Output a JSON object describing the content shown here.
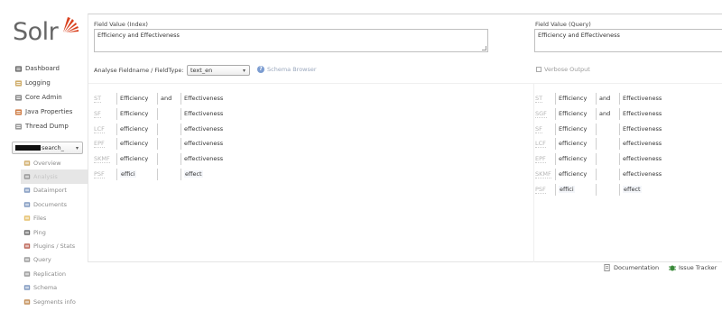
{
  "logo": {
    "text": "Solr",
    "accent_color": "#d9411e"
  },
  "nav": [
    {
      "label": "Dashboard",
      "icon": "dashboard-icon"
    },
    {
      "label": "Logging",
      "icon": "logging-icon"
    },
    {
      "label": "Core Admin",
      "icon": "core-admin-icon"
    },
    {
      "label": "Java Properties",
      "icon": "java-icon"
    },
    {
      "label": "Thread Dump",
      "icon": "thread-dump-icon"
    }
  ],
  "core_selector": {
    "value": "search_"
  },
  "core_menu": [
    {
      "label": "Overview",
      "icon": "overview-icon"
    },
    {
      "label": "Analysis",
      "icon": "analysis-icon",
      "active": true
    },
    {
      "label": "Dataimport",
      "icon": "dataimport-icon"
    },
    {
      "label": "Documents",
      "icon": "documents-icon"
    },
    {
      "label": "Files",
      "icon": "files-icon"
    },
    {
      "label": "Ping",
      "icon": "ping-icon"
    },
    {
      "label": "Plugins / Stats",
      "icon": "plugins-icon"
    },
    {
      "label": "Query",
      "icon": "query-icon"
    },
    {
      "label": "Replication",
      "icon": "replication-icon"
    },
    {
      "label": "Schema",
      "icon": "schema-icon"
    },
    {
      "label": "Segments info",
      "icon": "segments-icon"
    }
  ],
  "analysis": {
    "index_label": "Field Value (Index)",
    "index_value": "Efficiency and Effectiveness",
    "query_label": "Field Value (Query)",
    "query_value": "Efficiency and Effectiveness",
    "fieldtype_label": "Analyse Fieldname / FieldType:",
    "fieldtype_value": "text_en",
    "schema_browser": "Schema Browser",
    "verbose_label": "Verbose Output"
  },
  "index_rows": [
    {
      "stage": "ST",
      "t1": "Efficiency",
      "t2": "and",
      "t3": "Effectiveness"
    },
    {
      "stage": "SF",
      "t1": "Efficiency",
      "t2": "",
      "t3": "Effectiveness"
    },
    {
      "stage": "LCF",
      "t1": "efficiency",
      "t2": "",
      "t3": "effectiveness"
    },
    {
      "stage": "EPF",
      "t1": "efficiency",
      "t2": "",
      "t3": "effectiveness"
    },
    {
      "stage": "SKMF",
      "t1": "efficiency",
      "t2": "",
      "t3": "effectiveness"
    },
    {
      "stage": "PSF",
      "t1": "effici",
      "t2": "",
      "t3": "effect"
    }
  ],
  "query_rows": [
    {
      "stage": "ST",
      "t1": "Efficiency",
      "t2": "and",
      "t3": "Effectiveness"
    },
    {
      "stage": "SGF",
      "t1": "Efficiency",
      "t2": "and",
      "t3": "Effectiveness"
    },
    {
      "stage": "SF",
      "t1": "Efficiency",
      "t2": "",
      "t3": "Effectiveness"
    },
    {
      "stage": "LCF",
      "t1": "efficiency",
      "t2": "",
      "t3": "effectiveness"
    },
    {
      "stage": "EPF",
      "t1": "efficiency",
      "t2": "",
      "t3": "effectiveness"
    },
    {
      "stage": "SKMF",
      "t1": "efficiency",
      "t2": "",
      "t3": "effectiveness"
    },
    {
      "stage": "PSF",
      "t1": "effici",
      "t2": "",
      "t3": "effect"
    }
  ],
  "footer": {
    "documentation": "Documentation",
    "issue_tracker": "Issue Tracker"
  }
}
